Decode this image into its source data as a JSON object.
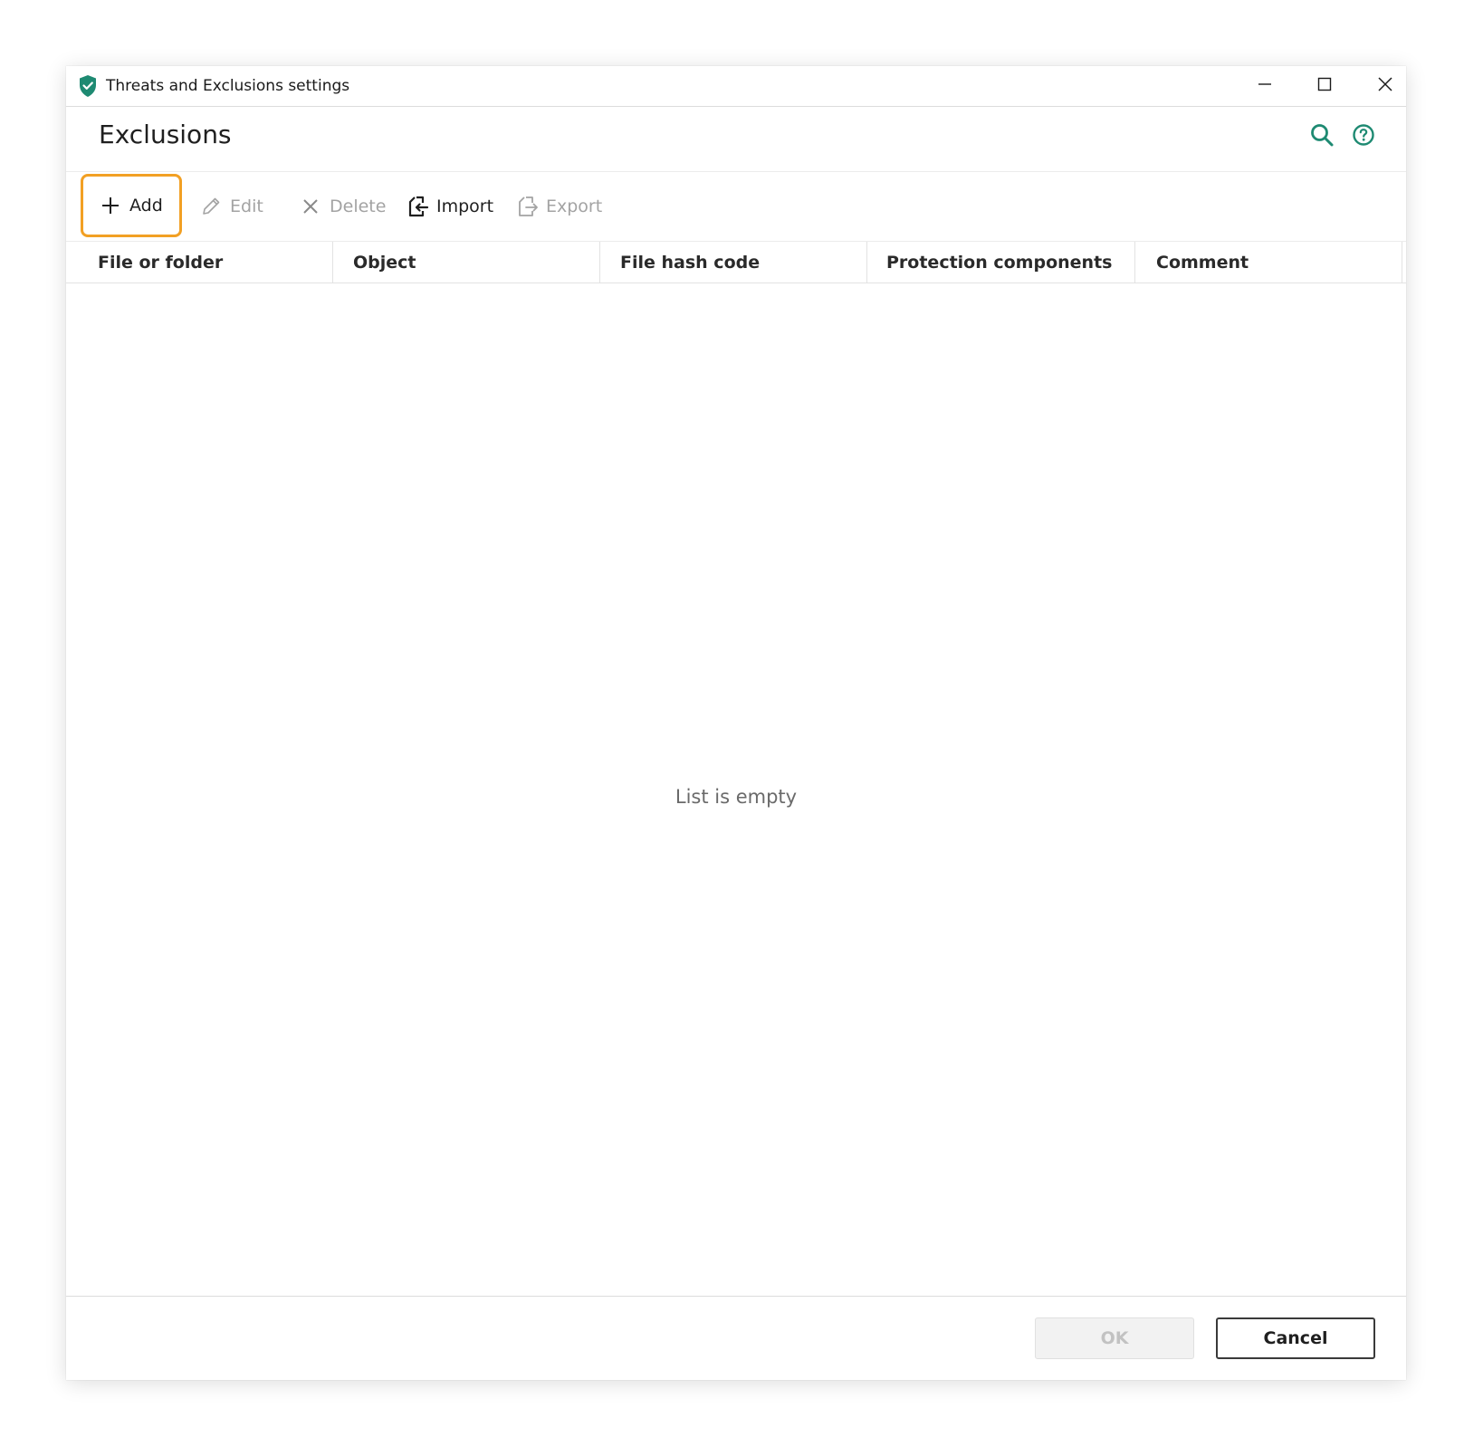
{
  "window": {
    "title": "Threats and Exclusions settings"
  },
  "header": {
    "title": "Exclusions"
  },
  "toolbar": {
    "add_label": "Add",
    "edit_label": "Edit",
    "delete_label": "Delete",
    "import_label": "Import",
    "export_label": "Export"
  },
  "table": {
    "columns": [
      "File or folder",
      "Object",
      "File hash code",
      "Protection components",
      "Comment"
    ],
    "empty_message": "List is empty"
  },
  "footer": {
    "ok_label": "OK",
    "cancel_label": "Cancel"
  },
  "colors": {
    "accent": "#1e8a72",
    "highlight": "#f2a024"
  },
  "icons": [
    "shield-icon",
    "minimize-icon",
    "maximize-icon",
    "close-icon",
    "search-icon",
    "help-icon",
    "plus-icon",
    "pencil-icon",
    "x-icon",
    "import-icon",
    "export-icon"
  ]
}
